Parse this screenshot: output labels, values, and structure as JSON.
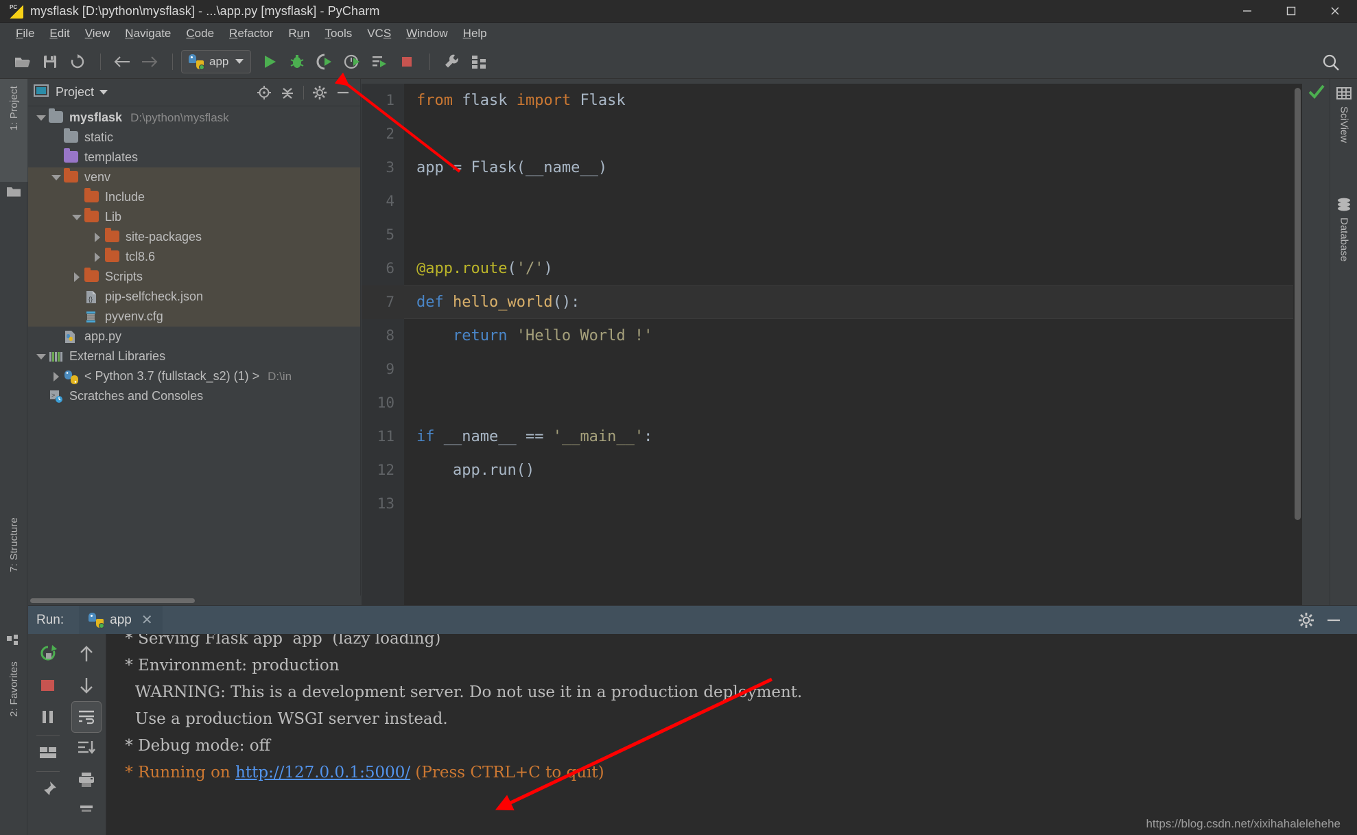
{
  "window": {
    "title": "mysflask [D:\\python\\mysflask] - ...\\app.py [mysflask] - PyCharm",
    "app_icon": "pycharm-icon",
    "minimize": "–",
    "maximize": "□",
    "close": "✕"
  },
  "menubar": {
    "items": [
      {
        "label": "File",
        "mnemonic": "F"
      },
      {
        "label": "Edit",
        "mnemonic": "E"
      },
      {
        "label": "View",
        "mnemonic": "V"
      },
      {
        "label": "Navigate",
        "mnemonic": "N"
      },
      {
        "label": "Code",
        "mnemonic": "C"
      },
      {
        "label": "Refactor",
        "mnemonic": "R"
      },
      {
        "label": "Run",
        "mnemonic": "u"
      },
      {
        "label": "Tools",
        "mnemonic": "T"
      },
      {
        "label": "VCS",
        "mnemonic": "S"
      },
      {
        "label": "Window",
        "mnemonic": "W"
      },
      {
        "label": "Help",
        "mnemonic": "H"
      }
    ]
  },
  "toolbar": {
    "open_label": "open-folder",
    "save_label": "save-all",
    "sync_label": "sync",
    "back_label": "back",
    "forward_label": "forward",
    "run_config": "app",
    "run_label": "run",
    "debug_label": "debug",
    "coverage_label": "run-with-coverage",
    "profile_label": "profile",
    "attach_label": "run-tests",
    "stop_label": "stop",
    "settings_label": "settings",
    "structure_label": "project-structure",
    "search_label": "search-everywhere"
  },
  "left_tabs": [
    {
      "label": "1: Project",
      "selected": true
    },
    {
      "label": "7: Structure",
      "selected": false
    },
    {
      "label": "2: Favorites",
      "selected": false
    }
  ],
  "right_tabs": [
    {
      "label": "SciView"
    },
    {
      "label": "Database"
    }
  ],
  "project": {
    "title": "Project",
    "tree": [
      {
        "label": "mysflask",
        "path": "D:\\python\\mysflask",
        "icon": "folder-module",
        "arrow": "down",
        "depth": 0,
        "bold": true,
        "color": "#8d959b"
      },
      {
        "label": "static",
        "path": "",
        "icon": "folder-resource",
        "arrow": "none",
        "depth": 1,
        "bold": false,
        "color": "#8d959b"
      },
      {
        "label": "templates",
        "path": "",
        "icon": "folder-template",
        "arrow": "none",
        "depth": 1,
        "bold": false,
        "color": "#9876c8"
      },
      {
        "label": "venv",
        "path": "",
        "icon": "folder-excluded",
        "arrow": "down",
        "depth": 1,
        "bold": false,
        "color": "#c2592c"
      },
      {
        "label": "Include",
        "path": "",
        "icon": "folder-excluded",
        "arrow": "none",
        "depth": 2,
        "bold": false,
        "color": "#c2592c"
      },
      {
        "label": "Lib",
        "path": "",
        "icon": "folder-excluded",
        "arrow": "down",
        "depth": 2,
        "bold": false,
        "color": "#c2592c"
      },
      {
        "label": "site-packages",
        "path": "",
        "icon": "folder-excluded",
        "arrow": "right",
        "depth": 3,
        "bold": false,
        "color": "#c2592c"
      },
      {
        "label": "tcl8.6",
        "path": "",
        "icon": "folder-excluded",
        "arrow": "right",
        "depth": 3,
        "bold": false,
        "color": "#c2592c"
      },
      {
        "label": "Scripts",
        "path": "",
        "icon": "folder-excluded",
        "arrow": "right",
        "depth": 2,
        "bold": false,
        "color": "#c2592c"
      },
      {
        "label": "pip-selfcheck.json",
        "path": "",
        "icon": "json-file",
        "arrow": "none",
        "depth": 2,
        "bold": false,
        "color": "#9aa0a6"
      },
      {
        "label": "pyvenv.cfg",
        "path": "",
        "icon": "config-file",
        "arrow": "none",
        "depth": 2,
        "bold": false,
        "color": "#4aa8d8"
      },
      {
        "label": "app.py",
        "path": "",
        "icon": "python-file",
        "arrow": "none",
        "depth": 1,
        "bold": false,
        "color": "#4b8bbe"
      },
      {
        "label": "External Libraries",
        "path": "",
        "icon": "library-icon",
        "arrow": "down",
        "depth": 0,
        "bold": false,
        "color": "#6aa84f"
      },
      {
        "label": "< Python 3.7 (fullstack_s2) (1) >",
        "path": "D:\\in",
        "icon": "python-icon",
        "arrow": "right",
        "depth": 1,
        "bold": false,
        "color": "#4b8bbe"
      },
      {
        "label": "Scratches and Consoles",
        "path": "",
        "icon": "scratches-icon",
        "arrow": "none",
        "depth": 0,
        "bold": false,
        "color": "#9aa0a6"
      }
    ]
  },
  "editor": {
    "filename": "app.py",
    "current_line": 7,
    "lines": [
      {
        "no": "1",
        "tokens": [
          {
            "t": "from ",
            "c": "kw"
          },
          {
            "t": "flask ",
            "c": "pl"
          },
          {
            "t": "import ",
            "c": "kw"
          },
          {
            "t": "Flask",
            "c": "pl"
          }
        ]
      },
      {
        "no": "2",
        "tokens": []
      },
      {
        "no": "3",
        "tokens": [
          {
            "t": "app = Flask(__name__)",
            "c": "pl"
          }
        ]
      },
      {
        "no": "4",
        "tokens": []
      },
      {
        "no": "5",
        "tokens": []
      },
      {
        "no": "6",
        "tokens": [
          {
            "t": "@app.route",
            "c": "dec"
          },
          {
            "t": "(",
            "c": "pl"
          },
          {
            "t": "'/'",
            "c": "str"
          },
          {
            "t": ")",
            "c": "pl"
          }
        ]
      },
      {
        "no": "7",
        "tokens": [
          {
            "t": "def ",
            "c": "kwb"
          },
          {
            "t": "hello_world",
            "c": "fn"
          },
          {
            "t": "():",
            "c": "pl"
          }
        ]
      },
      {
        "no": "8",
        "tokens": [
          {
            "t": "    ",
            "c": "pl"
          },
          {
            "t": "return ",
            "c": "kwb"
          },
          {
            "t": "'Hello World !'",
            "c": "str"
          }
        ]
      },
      {
        "no": "9",
        "tokens": []
      },
      {
        "no": "10",
        "tokens": []
      },
      {
        "no": "11",
        "tokens": [
          {
            "t": "if ",
            "c": "kwb"
          },
          {
            "t": "__name__ == ",
            "c": "pl"
          },
          {
            "t": "'__main__'",
            "c": "str"
          },
          {
            "t": ":",
            "c": "pl"
          }
        ]
      },
      {
        "no": "12",
        "tokens": [
          {
            "t": "    app.run()",
            "c": "pl"
          }
        ]
      },
      {
        "no": "13",
        "tokens": []
      }
    ]
  },
  "run_panel": {
    "label": "Run:",
    "tab_name": "app",
    "close_label": "✕",
    "settings_label": "settings",
    "minimize_label": "minimize",
    "toolbar_left": [
      "rerun-icon",
      "stop-icon",
      "pause-icon",
      "layout-icon",
      "pin-icon"
    ],
    "toolbar_right": [
      "up-icon",
      "down-icon",
      "soft-wrap-icon",
      "scroll-to-end-icon",
      "print-icon",
      "clear-all-icon"
    ],
    "console_lines": [
      {
        "text": " * Serving Flask app  app  (lazy loading)",
        "style": "normal"
      },
      {
        "text": " * Environment: production",
        "style": "normal"
      },
      {
        "text": "   WARNING: This is a development server. Do not use it in a production deployment.",
        "style": "normal"
      },
      {
        "text": "   Use a production WSGI server instead.",
        "style": "normal"
      },
      {
        "text": " * Debug mode: off",
        "style": "normal"
      }
    ],
    "running_line": {
      "prefix": " * Running on ",
      "url": "http://127.0.0.1:5000/",
      "suffix": " (Press CTRL+C to quit)",
      "style": "orange"
    }
  },
  "watermark": "https://blog.csdn.net/xixihahalelehehe",
  "colors": {
    "accent_green": "#4caf50",
    "accent_red": "#c75450",
    "link_blue": "#5394ec",
    "orange": "#cc7832",
    "bg_dark": "#2b2b2b",
    "bg_panel": "#3c3f41",
    "annotation_red": "#ff0000"
  }
}
